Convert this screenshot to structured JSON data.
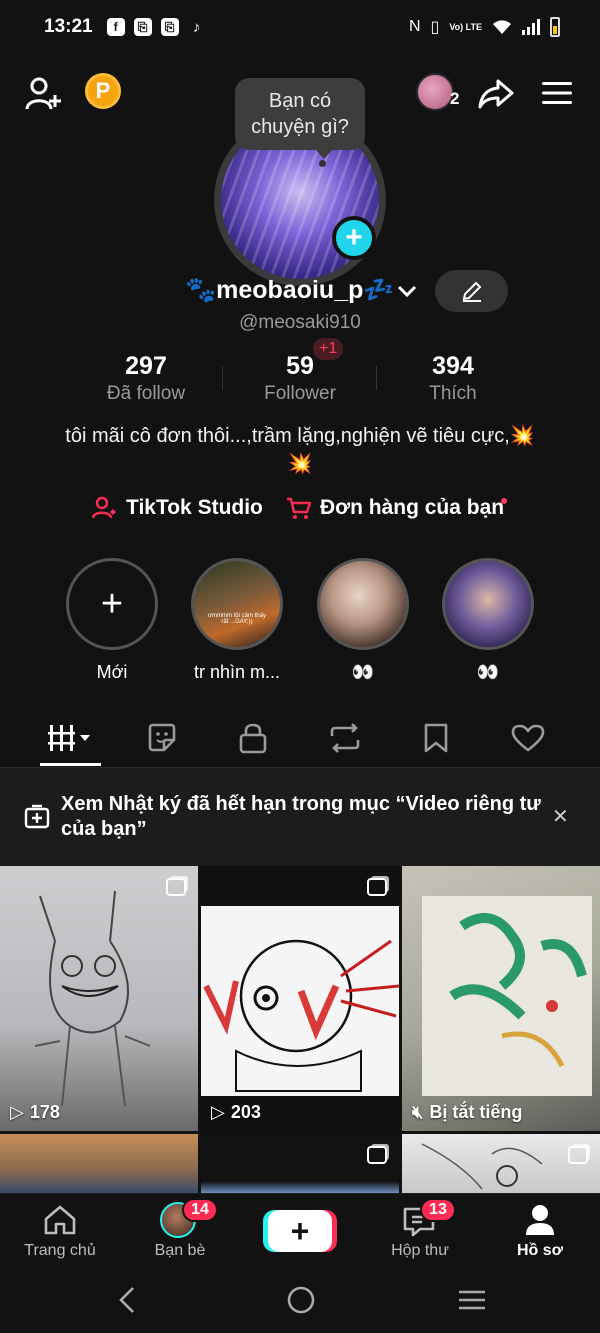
{
  "status_bar": {
    "time": "13:21",
    "apps": [
      "f",
      "⎘",
      "⎘",
      "♪"
    ],
    "icons": [
      "nfc-icon",
      "vibrate-icon",
      "volte-icon",
      "wifi-icon",
      "signal-icon",
      "battery-icon"
    ],
    "volte": "Vo) LTE"
  },
  "header": {
    "coin_letter": "P",
    "friend_count": "2"
  },
  "profile": {
    "tooltip": "Bạn có chuyện gì?",
    "display_name": "🐾meobaoiu_p💤",
    "username": "@meosaki910",
    "stats": [
      {
        "value": "297",
        "label": "Đã follow"
      },
      {
        "value": "59",
        "label": "Follower"
      },
      {
        "value": "394",
        "label": "Thích"
      }
    ],
    "new_followers": "+1",
    "bio": "tôi mãi cô đơn thôi...,trầm lặng,nghiện vẽ tiêu cực,💥💥"
  },
  "links": {
    "studio": "TikTok Studio",
    "orders": "Đơn hàng của bạn"
  },
  "highlights": [
    {
      "label": "Mới",
      "overlay": ""
    },
    {
      "label": "tr nhìn m...",
      "overlay": "ơmmmm tôi cảm thấy rất ...GAY;))"
    },
    {
      "label": "👀",
      "overlay": ""
    },
    {
      "label": "👀",
      "overlay": ""
    }
  ],
  "notice": {
    "text": "Xem Nhật ký đã hết hạn trong mục “Video riêng tư của bạn”"
  },
  "videos": [
    {
      "count": "178",
      "muted": false
    },
    {
      "count": "203",
      "muted": false
    },
    {
      "count": "Bị tắt tiếng",
      "muted": true
    },
    {
      "count": "",
      "muted": false
    },
    {
      "count": "",
      "muted": false
    },
    {
      "count": "",
      "muted": false
    }
  ],
  "nav": {
    "home": "Trang chủ",
    "friends": "Bạn bè",
    "friends_badge": "14",
    "inbox": "Hộp thư",
    "inbox_badge": "13",
    "profile": "Hồ sơ",
    "create": "+"
  },
  "colors": {
    "accent_red": "#fe2c55",
    "accent_cyan": "#20d5ec",
    "background": "#121212"
  }
}
